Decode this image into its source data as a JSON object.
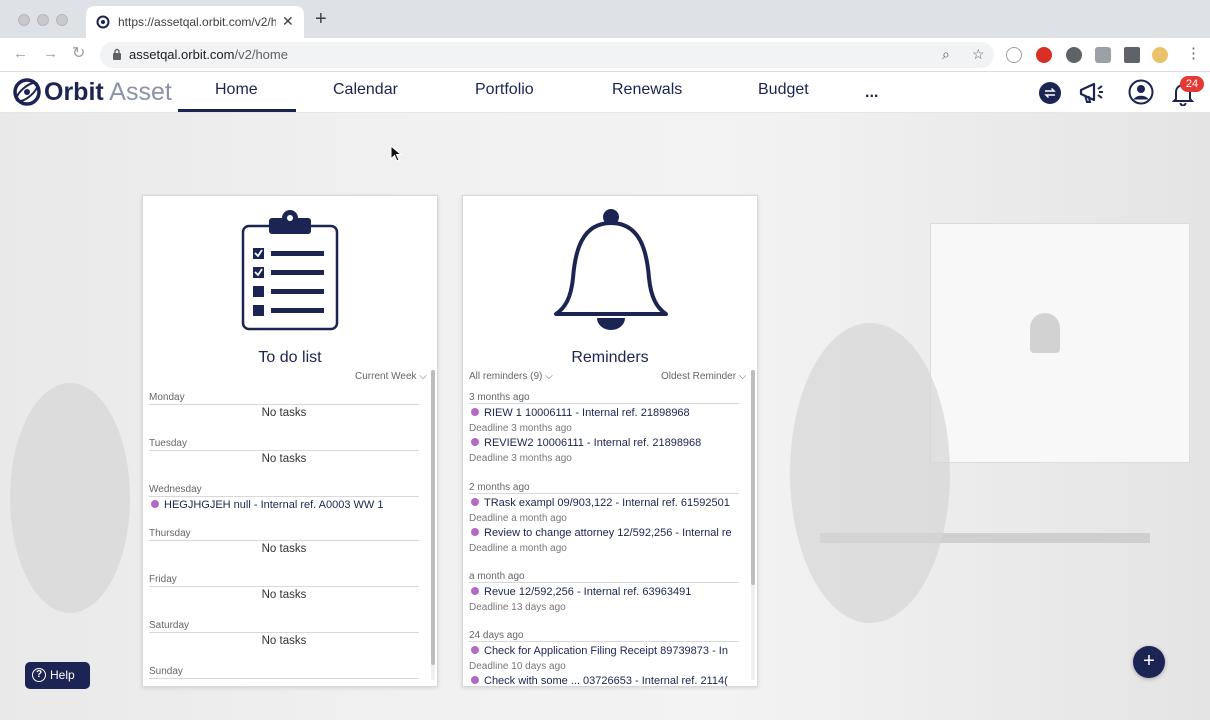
{
  "browser": {
    "tab_title": "https://assetqal.orbit.com/v2/h",
    "url_host": "assetqal.orbit.com",
    "url_path": "/v2/home"
  },
  "app": {
    "logo_orbit": "Orbit",
    "logo_asset": "Asset",
    "nav": [
      "Home",
      "Calendar",
      "Portfolio",
      "Renewals",
      "Budget",
      "..."
    ],
    "active_nav": "Home",
    "notification_count": "24",
    "brand_color": "#1b2452"
  },
  "todo": {
    "title": "To do list",
    "filter": "Current Week",
    "days": [
      {
        "day": "Monday",
        "empty": "No tasks"
      },
      {
        "day": "Tuesday",
        "empty": "No tasks"
      },
      {
        "day": "Wednesday",
        "task": "HEGJHGJEH null - Internal ref. A0003 WW 1"
      },
      {
        "day": "Thursday",
        "empty": "No tasks"
      },
      {
        "day": "Friday",
        "empty": "No tasks"
      },
      {
        "day": "Saturday",
        "empty": "No tasks"
      },
      {
        "day": "Sunday"
      }
    ]
  },
  "reminders": {
    "title": "Reminders",
    "filter_all": "All reminders (9)",
    "filter_sort": "Oldest Reminder",
    "groups": [
      {
        "label": "3 months ago",
        "items": [
          {
            "title": "RIEW 1 10006111 - Internal ref. 21898968",
            "deadline": "Deadline 3 months ago"
          },
          {
            "title": "REVIEW2 10006111 - Internal ref. 21898968",
            "deadline": "Deadline 3 months ago"
          }
        ]
      },
      {
        "label": "2 months ago",
        "items": [
          {
            "title": "TRask exampl 09/903,122 - Internal ref. 61592501",
            "deadline": "Deadline a month ago"
          },
          {
            "title": "Review to change attorney 12/592,256 - Internal re",
            "deadline": "Deadline a month ago"
          }
        ]
      },
      {
        "label": "a month ago",
        "items": [
          {
            "title": "Revue 12/592,256 - Internal ref. 63963491",
            "deadline": "Deadline 13 days ago"
          }
        ]
      },
      {
        "label": "24 days ago",
        "items": [
          {
            "title": "Check for Application Filing Receipt 89739873 - In",
            "deadline": "Deadline 10 days ago"
          },
          {
            "title": "Check with some ... 03726653 - Internal ref. 2114(",
            "deadline": ""
          }
        ]
      }
    ]
  },
  "help_label": "Help",
  "fab_label": "+"
}
